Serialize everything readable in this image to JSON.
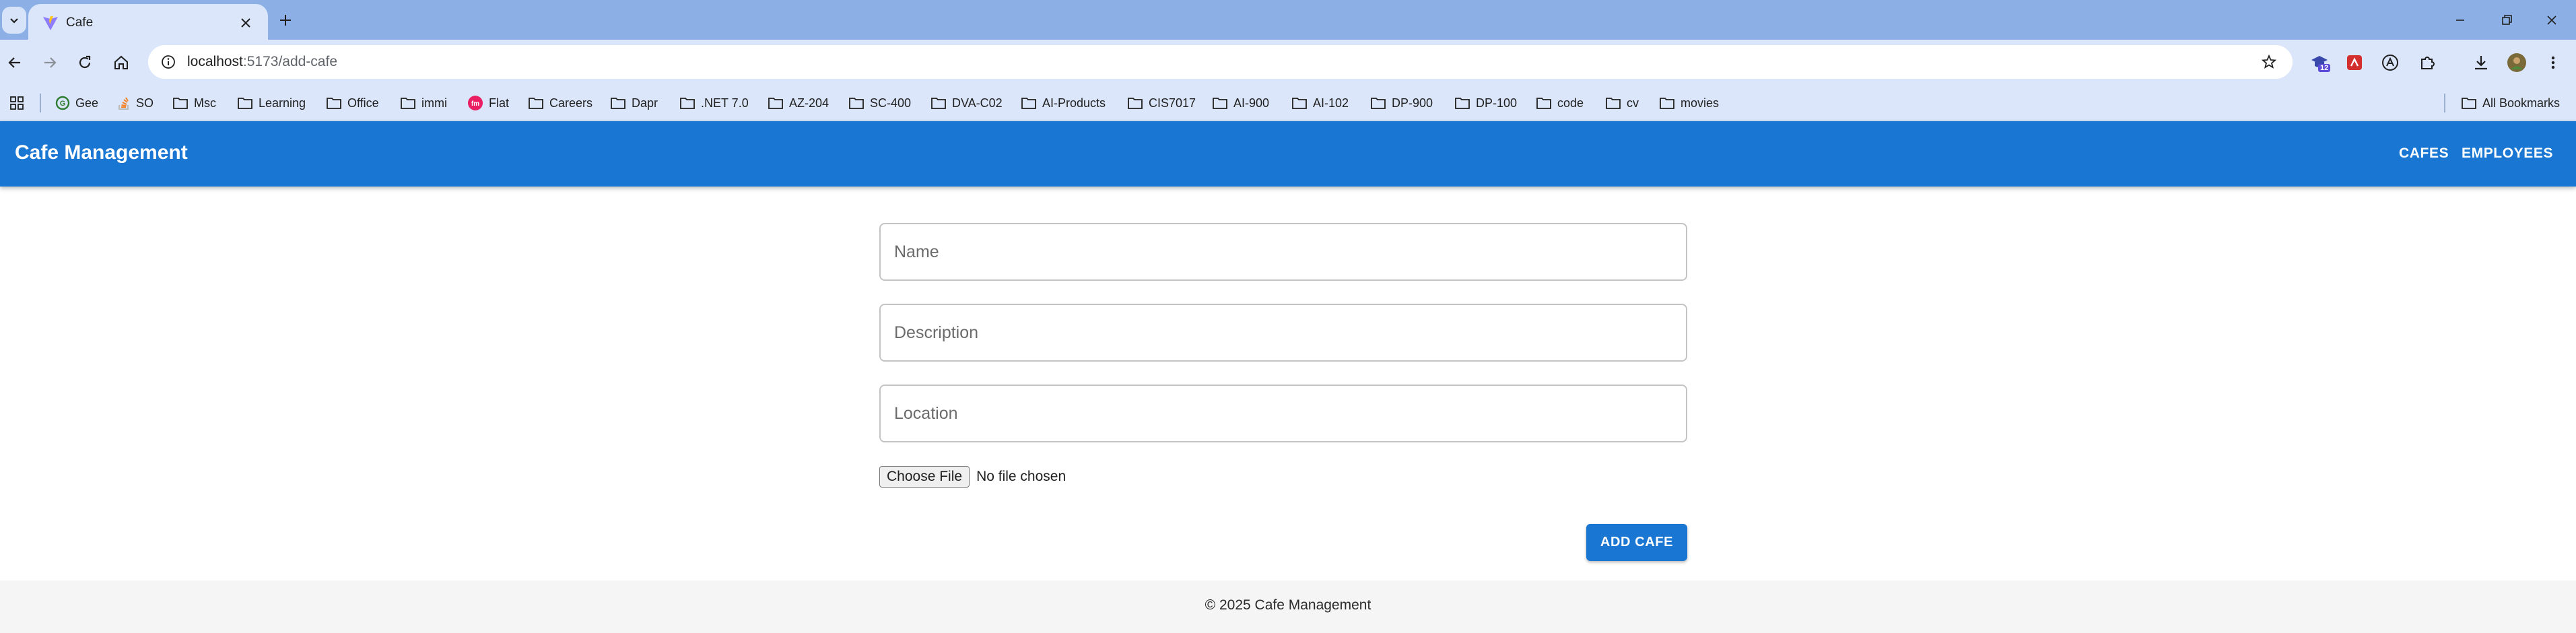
{
  "browser": {
    "tab": {
      "title": "Cafe"
    },
    "address": {
      "host": "localhost",
      "path": ":5173/add-cafe"
    },
    "bookmarks": [
      {
        "label": "Gee",
        "icon": "gee-favicon"
      },
      {
        "label": "SO",
        "icon": "stackoverflow-favicon"
      },
      {
        "label": "Msc",
        "icon": "folder-icon"
      },
      {
        "label": "Learning",
        "icon": "folder-icon"
      },
      {
        "label": "Office",
        "icon": "folder-icon"
      },
      {
        "label": "immi",
        "icon": "folder-icon"
      },
      {
        "label": "Flat",
        "icon": "flat-favicon"
      },
      {
        "label": "Careers",
        "icon": "folder-icon"
      },
      {
        "label": "Dapr",
        "icon": "folder-icon"
      },
      {
        "label": ".NET 7.0",
        "icon": "folder-icon"
      },
      {
        "label": "AZ-204",
        "icon": "folder-icon"
      },
      {
        "label": "SC-400",
        "icon": "folder-icon"
      },
      {
        "label": "DVA-C02",
        "icon": "folder-icon"
      },
      {
        "label": "AI-Products",
        "icon": "folder-icon"
      },
      {
        "label": "CIS7017",
        "icon": "folder-icon"
      },
      {
        "label": "AI-900",
        "icon": "folder-icon"
      },
      {
        "label": "AI-102",
        "icon": "folder-icon"
      },
      {
        "label": "DP-900",
        "icon": "folder-icon"
      },
      {
        "label": "DP-100",
        "icon": "folder-icon"
      },
      {
        "label": "code",
        "icon": "folder-icon"
      },
      {
        "label": "cv",
        "icon": "folder-icon"
      },
      {
        "label": "movies",
        "icon": "folder-icon"
      }
    ],
    "all_bookmarks_label": "All Bookmarks",
    "extension_badge": "12",
    "colors": {
      "tabstrip": "#8cb0e6",
      "toolbar": "#dbe6fa"
    }
  },
  "app": {
    "title": "Cafe Management",
    "nav": {
      "cafes": "CAFES",
      "employees": "EMPLOYEES"
    },
    "colors": {
      "primary": "#1976d2"
    }
  },
  "form": {
    "name_placeholder": "Name",
    "description_placeholder": "Description",
    "location_placeholder": "Location",
    "file_button": "Choose File",
    "file_status": "No file chosen",
    "submit_label": "ADD CAFE"
  },
  "footer": {
    "text": "© 2025 Cafe Management"
  }
}
